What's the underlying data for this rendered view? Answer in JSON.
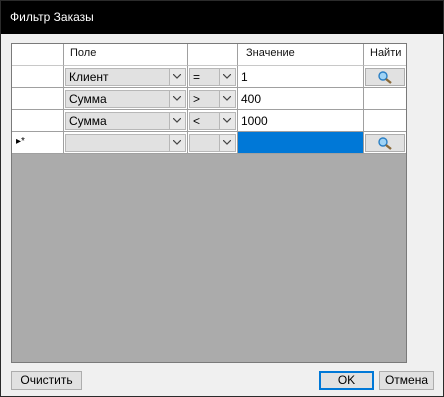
{
  "window": {
    "title": "Фильтр Заказы"
  },
  "grid": {
    "columns": [
      {
        "label": ""
      },
      {
        "label": "Поле"
      },
      {
        "label": ""
      },
      {
        "label": "Значение"
      },
      {
        "label": "Найти"
      }
    ],
    "rows": [
      {
        "field": "Клиент",
        "op": "=",
        "value": "1",
        "has_find": true,
        "marker": ""
      },
      {
        "field": "Сумма",
        "op": ">",
        "value": "400",
        "has_find": false,
        "marker": ""
      },
      {
        "field": "Сумма",
        "op": "<",
        "value": "1000",
        "has_find": false,
        "marker": ""
      },
      {
        "field": "",
        "op": "",
        "value": "",
        "has_find": true,
        "marker": "▸*"
      }
    ]
  },
  "buttons": {
    "clear": "Очистить",
    "ok": "OK",
    "cancel": "Отмена"
  },
  "icons": {
    "find": "magnifier-icon",
    "dropdown": "chevron-down-icon",
    "new_row": "new-row-marker-icon"
  },
  "colors": {
    "selection": "#0078d7",
    "grid_background": "#ababab",
    "title_bar": "#000000"
  }
}
